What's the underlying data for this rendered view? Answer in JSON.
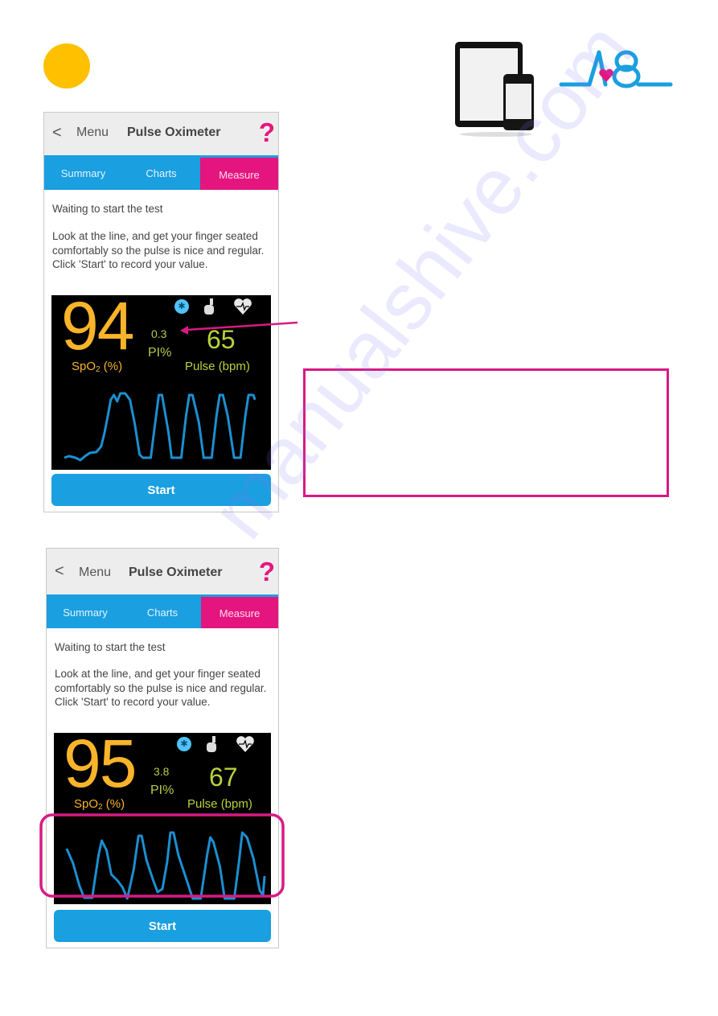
{
  "page": {
    "step_marker_color": "#ffc000",
    "brand_logo_text": "A8",
    "accent_pink": "#e5157f",
    "accent_blue": "#1a9fe0",
    "watermark": "manualshive.com"
  },
  "screens": [
    {
      "nav": {
        "back": "<",
        "menu": "Menu",
        "title": "Pulse Oximeter",
        "help": "?"
      },
      "tabs": [
        {
          "label": "Summary",
          "active": false
        },
        {
          "label": "Charts",
          "active": false
        },
        {
          "label": "Measure",
          "active": true
        }
      ],
      "status": "Waiting to start the test",
      "instructions": "Look at the line, and get your finger seated comfortably so the pulse is nice and regular.  Click 'Start' to record your value.",
      "monitor": {
        "spo2_value": "94",
        "spo2_label_main": "SpO",
        "spo2_label_sub": "2",
        "spo2_label_unit": " (%)",
        "pi_value": "0.3",
        "pi_label": "PI%",
        "pulse_value": "65",
        "pulse_label": "Pulse (bpm)",
        "icons": [
          "bluetooth-icon",
          "finger-sensor-icon",
          "heart-rate-icon"
        ],
        "waveform": "irregular"
      },
      "start_label": "Start"
    },
    {
      "nav": {
        "back": "<",
        "menu": "Menu",
        "title": "Pulse Oximeter",
        "help": "?"
      },
      "tabs": [
        {
          "label": "Summary",
          "active": false
        },
        {
          "label": "Charts",
          "active": false
        },
        {
          "label": "Measure",
          "active": true
        }
      ],
      "status": "Waiting to start the test",
      "instructions": "Look at the line, and get your finger seated comfortably so the pulse is nice and regular.  Click 'Start' to record your value.",
      "monitor": {
        "spo2_value": "95",
        "spo2_label_main": "SpO",
        "spo2_label_sub": "2",
        "spo2_label_unit": " (%)",
        "pi_value": "3.8",
        "pi_label": "PI%",
        "pulse_value": "67",
        "pulse_label": "Pulse (bpm)",
        "icons": [
          "bluetooth-icon",
          "finger-sensor-icon",
          "heart-rate-icon"
        ],
        "waveform": "regular"
      },
      "start_label": "Start"
    }
  ]
}
